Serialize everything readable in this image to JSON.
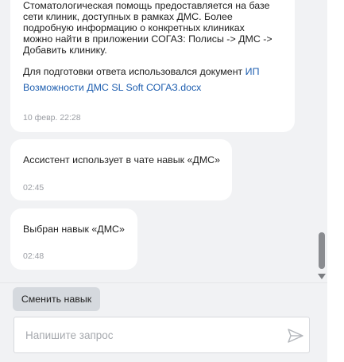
{
  "chat": {
    "messages": [
      {
        "text": "Стоматологическая помощь предоставляется на базе\nсети клиник, доступных в рамках ДМС. Более\nподробную информацию о конкретных клиниках\nможно найти в приложении СОГАЗ: Полисы -> ДМС ->\nДобавить клинику.",
        "source_prefix": "Для подготовки ответа использовался документ",
        "source_link": "ИП Возможности ДМС SL Soft СОГАЗ.docx",
        "time": "10 февр. 22:28"
      },
      {
        "text": "Ассистент использует в чате навык «ДМС»",
        "time": "02:45"
      },
      {
        "text": "Выбран навык «ДМС»",
        "time": "02:48"
      }
    ]
  },
  "controls": {
    "switch_skill_label": "Сменить навык",
    "input_placeholder": "Напишите запрос",
    "input_value": ""
  },
  "icons": {
    "send": "send-icon",
    "scroll_down": "chevron-down-icon"
  },
  "colors": {
    "background": "#f1f2f4",
    "bubble": "#ffffff",
    "link": "#1f5fb0",
    "timestamp": "#9a9da3",
    "button": "#d5d9de"
  }
}
